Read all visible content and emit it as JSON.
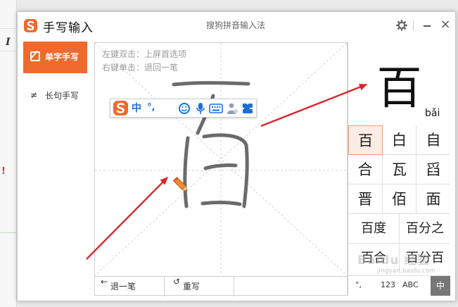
{
  "window": {
    "app_title": "手写输入",
    "brand_title": "搜狗拼音输入法"
  },
  "background": {
    "italic_button": "I",
    "exclaim": "!"
  },
  "sidebar": {
    "items": [
      {
        "label": "单字手写",
        "active": true,
        "icon": "pen-box-icon"
      },
      {
        "label": "长句手写",
        "active": false,
        "icon": "scribble-icon",
        "icon_glyph": "≠"
      }
    ]
  },
  "canvas": {
    "hint_line1": "左键双击：上屏首选项",
    "hint_line2": "右键单击：退回一笔",
    "toolbar": {
      "lang_label": "中",
      "punct_label": "°,",
      "icons": [
        "sogou-logo-icon",
        "emoji-icon",
        "mic-icon",
        "keyboard-icon",
        "user-icon",
        "shirt-icon",
        "grid-icon"
      ]
    },
    "actions": {
      "undo_icon": "←",
      "undo_label": "退一笔",
      "reset_icon": "↺",
      "reset_label": "重写"
    }
  },
  "result": {
    "top_char": "百",
    "pinyin": "bǎi",
    "candidates": [
      "百",
      "白",
      "自",
      "合",
      "瓦",
      "舀",
      "晋",
      "佰",
      "面",
      "百度",
      "百分之",
      "百合",
      "百分百"
    ],
    "footer": {
      "symbol_label": "°,",
      "number_label": "123",
      "abc_label": "ABC",
      "zh_label": "中"
    }
  },
  "watermark": {
    "text": "Baidu 经验",
    "url": "jingyan.baidu.com"
  },
  "colors": {
    "accent": "#f06a2e",
    "toolbar_blue": "#1d6fd6",
    "arrow_red": "#d8262a",
    "stroke_gray": "#6b6b6b"
  }
}
